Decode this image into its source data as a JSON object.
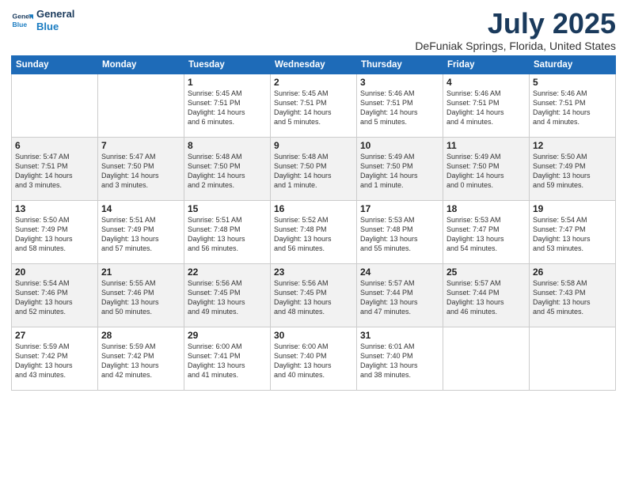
{
  "header": {
    "logo_line1": "General",
    "logo_line2": "Blue",
    "month": "July 2025",
    "location": "DeFuniak Springs, Florida, United States"
  },
  "weekdays": [
    "Sunday",
    "Monday",
    "Tuesday",
    "Wednesday",
    "Thursday",
    "Friday",
    "Saturday"
  ],
  "weeks": [
    [
      {
        "day": "",
        "info": ""
      },
      {
        "day": "",
        "info": ""
      },
      {
        "day": "1",
        "info": "Sunrise: 5:45 AM\nSunset: 7:51 PM\nDaylight: 14 hours\nand 6 minutes."
      },
      {
        "day": "2",
        "info": "Sunrise: 5:45 AM\nSunset: 7:51 PM\nDaylight: 14 hours\nand 5 minutes."
      },
      {
        "day": "3",
        "info": "Sunrise: 5:46 AM\nSunset: 7:51 PM\nDaylight: 14 hours\nand 5 minutes."
      },
      {
        "day": "4",
        "info": "Sunrise: 5:46 AM\nSunset: 7:51 PM\nDaylight: 14 hours\nand 4 minutes."
      },
      {
        "day": "5",
        "info": "Sunrise: 5:46 AM\nSunset: 7:51 PM\nDaylight: 14 hours\nand 4 minutes."
      }
    ],
    [
      {
        "day": "6",
        "info": "Sunrise: 5:47 AM\nSunset: 7:51 PM\nDaylight: 14 hours\nand 3 minutes."
      },
      {
        "day": "7",
        "info": "Sunrise: 5:47 AM\nSunset: 7:50 PM\nDaylight: 14 hours\nand 3 minutes."
      },
      {
        "day": "8",
        "info": "Sunrise: 5:48 AM\nSunset: 7:50 PM\nDaylight: 14 hours\nand 2 minutes."
      },
      {
        "day": "9",
        "info": "Sunrise: 5:48 AM\nSunset: 7:50 PM\nDaylight: 14 hours\nand 1 minute."
      },
      {
        "day": "10",
        "info": "Sunrise: 5:49 AM\nSunset: 7:50 PM\nDaylight: 14 hours\nand 1 minute."
      },
      {
        "day": "11",
        "info": "Sunrise: 5:49 AM\nSunset: 7:50 PM\nDaylight: 14 hours\nand 0 minutes."
      },
      {
        "day": "12",
        "info": "Sunrise: 5:50 AM\nSunset: 7:49 PM\nDaylight: 13 hours\nand 59 minutes."
      }
    ],
    [
      {
        "day": "13",
        "info": "Sunrise: 5:50 AM\nSunset: 7:49 PM\nDaylight: 13 hours\nand 58 minutes."
      },
      {
        "day": "14",
        "info": "Sunrise: 5:51 AM\nSunset: 7:49 PM\nDaylight: 13 hours\nand 57 minutes."
      },
      {
        "day": "15",
        "info": "Sunrise: 5:51 AM\nSunset: 7:48 PM\nDaylight: 13 hours\nand 56 minutes."
      },
      {
        "day": "16",
        "info": "Sunrise: 5:52 AM\nSunset: 7:48 PM\nDaylight: 13 hours\nand 56 minutes."
      },
      {
        "day": "17",
        "info": "Sunrise: 5:53 AM\nSunset: 7:48 PM\nDaylight: 13 hours\nand 55 minutes."
      },
      {
        "day": "18",
        "info": "Sunrise: 5:53 AM\nSunset: 7:47 PM\nDaylight: 13 hours\nand 54 minutes."
      },
      {
        "day": "19",
        "info": "Sunrise: 5:54 AM\nSunset: 7:47 PM\nDaylight: 13 hours\nand 53 minutes."
      }
    ],
    [
      {
        "day": "20",
        "info": "Sunrise: 5:54 AM\nSunset: 7:46 PM\nDaylight: 13 hours\nand 52 minutes."
      },
      {
        "day": "21",
        "info": "Sunrise: 5:55 AM\nSunset: 7:46 PM\nDaylight: 13 hours\nand 50 minutes."
      },
      {
        "day": "22",
        "info": "Sunrise: 5:56 AM\nSunset: 7:45 PM\nDaylight: 13 hours\nand 49 minutes."
      },
      {
        "day": "23",
        "info": "Sunrise: 5:56 AM\nSunset: 7:45 PM\nDaylight: 13 hours\nand 48 minutes."
      },
      {
        "day": "24",
        "info": "Sunrise: 5:57 AM\nSunset: 7:44 PM\nDaylight: 13 hours\nand 47 minutes."
      },
      {
        "day": "25",
        "info": "Sunrise: 5:57 AM\nSunset: 7:44 PM\nDaylight: 13 hours\nand 46 minutes."
      },
      {
        "day": "26",
        "info": "Sunrise: 5:58 AM\nSunset: 7:43 PM\nDaylight: 13 hours\nand 45 minutes."
      }
    ],
    [
      {
        "day": "27",
        "info": "Sunrise: 5:59 AM\nSunset: 7:42 PM\nDaylight: 13 hours\nand 43 minutes."
      },
      {
        "day": "28",
        "info": "Sunrise: 5:59 AM\nSunset: 7:42 PM\nDaylight: 13 hours\nand 42 minutes."
      },
      {
        "day": "29",
        "info": "Sunrise: 6:00 AM\nSunset: 7:41 PM\nDaylight: 13 hours\nand 41 minutes."
      },
      {
        "day": "30",
        "info": "Sunrise: 6:00 AM\nSunset: 7:40 PM\nDaylight: 13 hours\nand 40 minutes."
      },
      {
        "day": "31",
        "info": "Sunrise: 6:01 AM\nSunset: 7:40 PM\nDaylight: 13 hours\nand 38 minutes."
      },
      {
        "day": "",
        "info": ""
      },
      {
        "day": "",
        "info": ""
      }
    ]
  ]
}
